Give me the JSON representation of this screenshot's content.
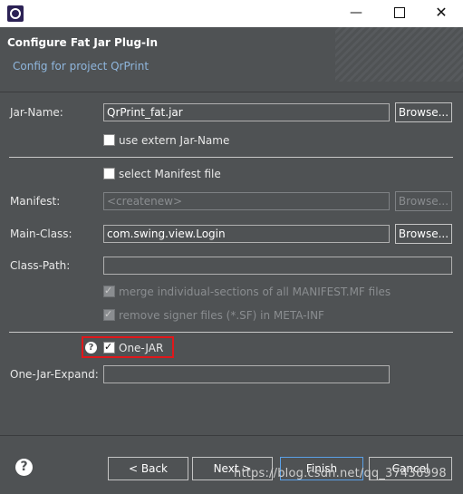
{
  "window": {
    "minimize_glyph": "—",
    "close_glyph": "✕"
  },
  "header": {
    "title": "Configure Fat Jar Plug-In",
    "subtitle": "Config for project QrPrint"
  },
  "form": {
    "jar_name": {
      "label": "Jar-Name:",
      "value": "QrPrint_fat.jar",
      "browse": "Browse..."
    },
    "use_extern": {
      "label": "use extern Jar-Name",
      "checked": false
    },
    "select_manifest": {
      "label": "select Manifest file",
      "checked": false
    },
    "manifest": {
      "label": "Manifest:",
      "value": "<createnew>",
      "browse": "Browse..."
    },
    "main_class": {
      "label": "Main-Class:",
      "value": "com.swing.view.Login",
      "browse": "Browse..."
    },
    "class_path": {
      "label": "Class-Path:",
      "value": ""
    },
    "merge_manifest": {
      "label": "merge individual-sections of all MANIFEST.MF files",
      "checked": true
    },
    "remove_signer": {
      "label": "remove signer files (*.SF) in META-INF",
      "checked": true
    },
    "one_jar": {
      "label": "One-JAR",
      "checked": true,
      "help": "?"
    },
    "one_jar_expand": {
      "label": "One-Jar-Expand:",
      "value": ""
    }
  },
  "footer": {
    "help": "?",
    "back": "< Back",
    "next": "Next >",
    "finish": "Finish",
    "cancel": "Cancel"
  },
  "watermark": "https://blog.csdn.net/qq_37436998",
  "colors": {
    "background": "#4f5254",
    "highlight": "#e0171b",
    "subtitle": "#8fb6dd"
  }
}
